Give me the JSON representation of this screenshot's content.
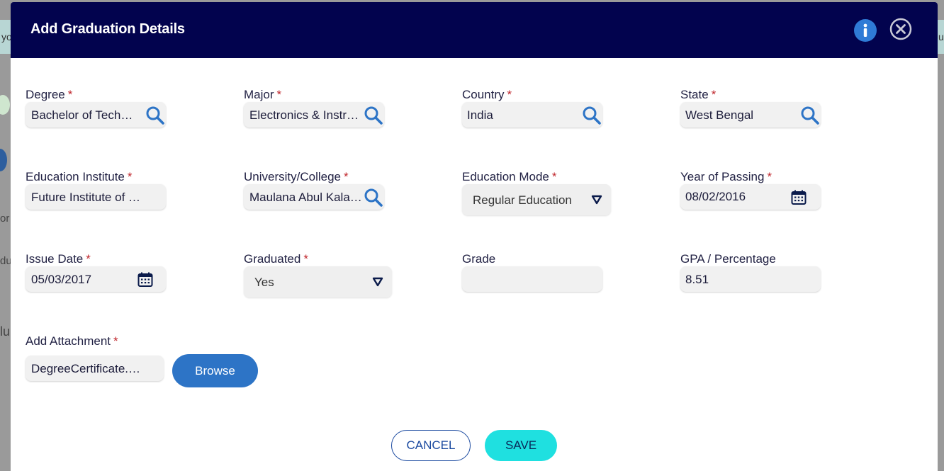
{
  "modal": {
    "title": "Add Graduation Details"
  },
  "background": {
    "left_text": "yo",
    "right_text": "u",
    "frag1": "or",
    "frag2": "du",
    "frag3": "lu"
  },
  "fields": {
    "degree": {
      "label": "Degree",
      "required": "*",
      "value": "Bachelor of Technology",
      "icon": "search-icon"
    },
    "major": {
      "label": "Major",
      "required": "*",
      "value": "Electronics & Instrumentation",
      "icon": "search-icon"
    },
    "country": {
      "label": "Country",
      "required": "*",
      "value": "India",
      "icon": "search-icon"
    },
    "state": {
      "label": "State",
      "required": "*",
      "value": "West Bengal",
      "icon": "search-icon"
    },
    "institute": {
      "label": "Education Institute",
      "required": "*",
      "value": "Future Institute of Engineering"
    },
    "university": {
      "label": "University/College",
      "required": "*",
      "value": "Maulana Abul Kalam Azad",
      "icon": "search-icon"
    },
    "mode": {
      "label": "Education Mode",
      "required": "*",
      "value": "Regular Education"
    },
    "year": {
      "label": "Year of Passing",
      "required": "*",
      "value": "08/02/2016",
      "icon": "calendar-icon"
    },
    "issue_date": {
      "label": "Issue Date",
      "required": "*",
      "value": "05/03/2017",
      "icon": "calendar-icon"
    },
    "graduated": {
      "label": "Graduated",
      "required": "*",
      "value": "Yes"
    },
    "grade": {
      "label": "Grade",
      "value": ""
    },
    "gpa": {
      "label": "GPA / Percentage",
      "value": "8.51"
    },
    "attachment": {
      "label": "Add Attachment",
      "required": "*",
      "value": "DegreeCertificate.pdf"
    }
  },
  "buttons": {
    "browse": "Browse",
    "cancel": "CANCEL",
    "save": "SAVE"
  },
  "colors": {
    "header": "#02034e",
    "primary": "#2d74c6",
    "save": "#1fe0e0",
    "required": "#c0282e"
  }
}
